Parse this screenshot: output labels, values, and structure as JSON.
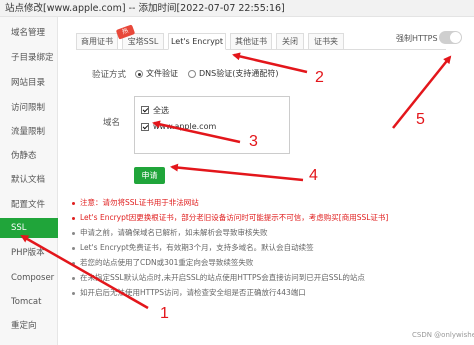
{
  "titlebar": {
    "text": "站点修改[www.apple.com] -- 添加时间[2022-07-07 22:55:16]"
  },
  "sidebar": {
    "items": [
      {
        "label": "域名管理"
      },
      {
        "label": "子目录绑定"
      },
      {
        "label": "网站目录"
      },
      {
        "label": "访问限制"
      },
      {
        "label": "流量限制"
      },
      {
        "label": "伪静态"
      },
      {
        "label": "默认文档"
      },
      {
        "label": "配置文件"
      },
      {
        "label": "SSL"
      },
      {
        "label": "PHP版本"
      },
      {
        "label": "Composer"
      },
      {
        "label": "Tomcat"
      },
      {
        "label": "重定向"
      }
    ],
    "active_index": 8
  },
  "tabs": {
    "items": [
      {
        "label": "商用证书"
      },
      {
        "label": "宝塔SSL"
      },
      {
        "label": "Let's Encrypt"
      },
      {
        "label": "其他证书"
      },
      {
        "label": "关闭"
      },
      {
        "label": "证书夹"
      }
    ],
    "active_index": 2,
    "hot_badge": "热"
  },
  "force_https": {
    "label": "强制HTTPS",
    "enabled": false
  },
  "verify": {
    "label": "验证方式",
    "options": [
      {
        "label": "文件验证",
        "checked": true
      },
      {
        "label": "DNS验证(支持通配符)",
        "checked": false
      }
    ]
  },
  "domains": {
    "label": "域名",
    "items": [
      {
        "label": "全选",
        "checked": true
      },
      {
        "label": "www.apple.com",
        "checked": true
      }
    ]
  },
  "apply_button": {
    "label": "申请"
  },
  "notes": [
    {
      "text": "注意：请勿将SSL证书用于非法网站",
      "style": "red"
    },
    {
      "text": "Let's Encrypt因更换根证书，部分老旧设备访问时可能提示不可信，考虑购买[商用SSL证书]",
      "style": "red"
    },
    {
      "text": "申请之前，请确保域名已解析，如未解析会导致审核失败",
      "style": "gray"
    },
    {
      "text": "Let's Encrypt免费证书，有效期3个月，支持多域名。默认会自动续签",
      "style": "gray"
    },
    {
      "text": "若您的站点使用了CDN或301重定向会导致续签失败",
      "style": "gray"
    },
    {
      "text": "在未指定SSL默认站点时,未开启SSL的站点使用HTTPS会直接访问到已开启SSL的站点",
      "style": "gray"
    },
    {
      "text": "如开启后无法使用HTTPS访问，请检查安全组是否正确放行443端口",
      "style": "gray"
    }
  ],
  "annotations": {
    "color": "#e3161b",
    "labels": [
      "1",
      "2",
      "3",
      "4",
      "5"
    ]
  },
  "watermark": {
    "text": "CSDN @onlywishes"
  }
}
